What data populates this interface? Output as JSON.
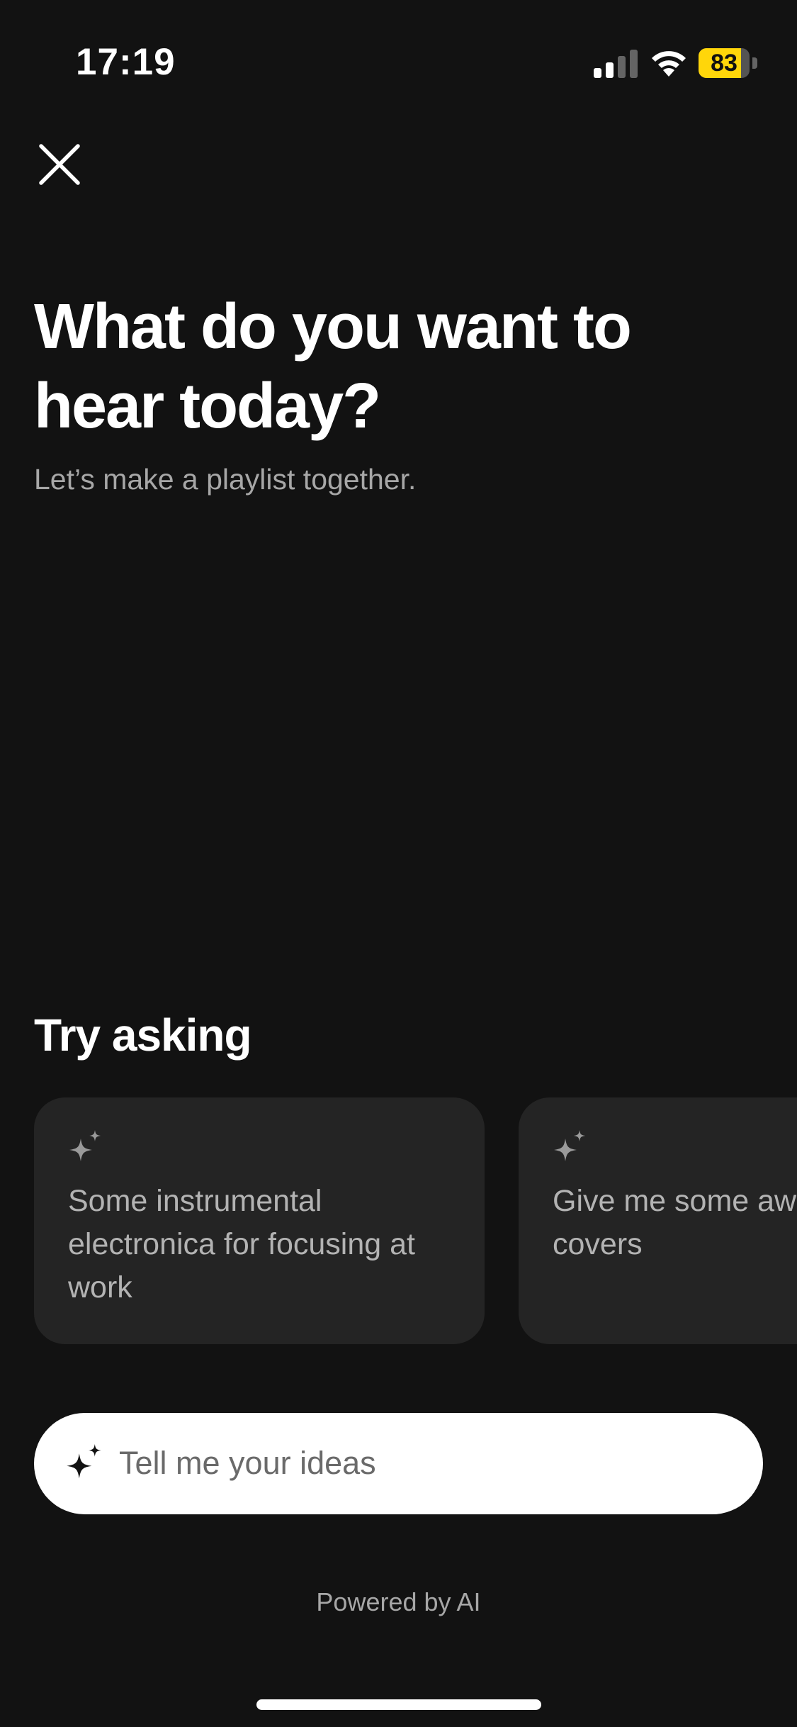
{
  "status_bar": {
    "time": "17:19",
    "battery_level": 83,
    "battery_text": "83",
    "battery_color": "#ffd60a"
  },
  "header": {
    "close_icon": "close-icon"
  },
  "main": {
    "headline": "What do you want to hear today?",
    "subhead": "Let’s make a playlist together."
  },
  "suggestions": {
    "title": "Try asking",
    "items": [
      {
        "icon": "sparkle-icon",
        "text": "Some instrumental electronica for focusing at work"
      },
      {
        "icon": "sparkle-icon",
        "text": "Give me some awesome covers"
      }
    ]
  },
  "prompt_input": {
    "icon": "sparkle-icon",
    "placeholder": "Tell me your ideas"
  },
  "footer": {
    "powered_by": "Powered by AI"
  },
  "colors": {
    "background": "#121212",
    "card": "#242424",
    "secondary_text": "#a7a7a7",
    "input_background": "#ffffff"
  }
}
